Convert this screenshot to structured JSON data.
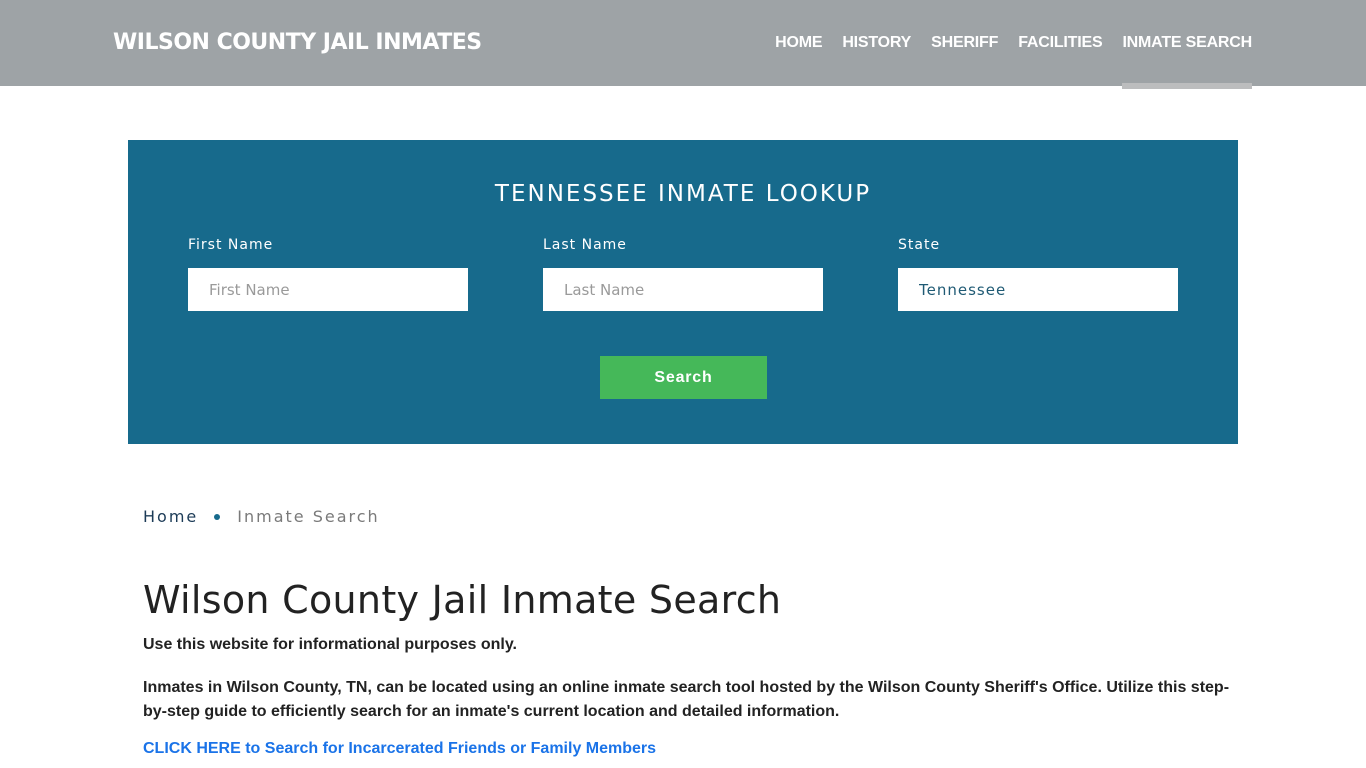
{
  "header": {
    "brand": "WILSON COUNTY JAIL INMATES",
    "nav": [
      {
        "label": "HOME",
        "active": false
      },
      {
        "label": "HISTORY",
        "active": false
      },
      {
        "label": "SHERIFF",
        "active": false
      },
      {
        "label": "FACILITIES",
        "active": false
      },
      {
        "label": "INMATE SEARCH",
        "active": true
      }
    ]
  },
  "lookup": {
    "title": "TENNESSEE INMATE LOOKUP",
    "first_name": {
      "label": "First Name",
      "placeholder": "First Name",
      "value": ""
    },
    "last_name": {
      "label": "Last Name",
      "placeholder": "Last Name",
      "value": ""
    },
    "state": {
      "label": "State",
      "value": "Tennessee"
    },
    "search_label": "Search"
  },
  "breadcrumb": {
    "home": "Home",
    "current": "Inmate Search"
  },
  "content": {
    "title": "Wilson County Jail Inmate Search",
    "disclaimer": "Use this website for informational purposes only.",
    "intro": "Inmates in Wilson County, TN, can be located using an online inmate search tool hosted by the Wilson County Sheriff's Office. Utilize this step-by-step guide to efficiently search for an inmate's current location and detailed information.",
    "cta_link": "CLICK HERE to Search for Incarcerated Friends or Family Members"
  },
  "colors": {
    "header_bg": "#9ea3a6",
    "lookup_bg": "#176a8c",
    "search_button": "#45b859",
    "link": "#1a73e8"
  }
}
